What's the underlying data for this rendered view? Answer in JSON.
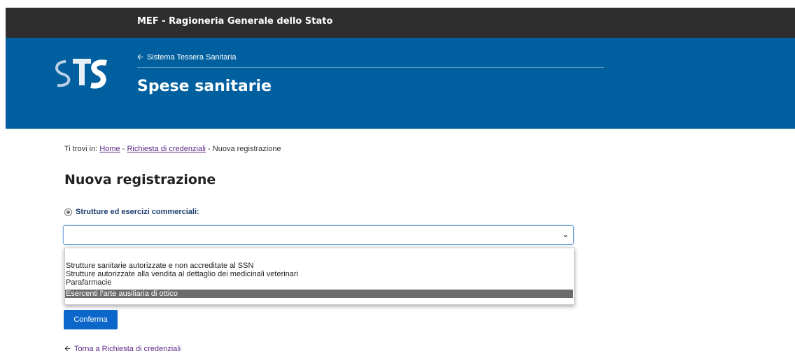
{
  "topbar": {
    "title": "MEF - Ragioneria Generale dello Stato"
  },
  "header": {
    "logo_text": "STS",
    "back_link": "Sistema Tessera Sanitaria",
    "title": "Spese sanitarie"
  },
  "breadcrumb": {
    "prefix": "Ti trovi in:",
    "items": [
      "Home",
      "Richiesta di credenziali",
      "Nuova registrazione"
    ],
    "separator": "-"
  },
  "page": {
    "title": "Nuova registrazione",
    "radio_label": "Strutture ed esercizi commerciali:",
    "select_value": "",
    "options": [
      "Strutture sanitarie autorizzate e non accreditate al SSN",
      "Strutture autorizzate alla vendita al dettaglio dei medicinali veterinari",
      "Parafarmacie",
      "Esercenti l'arte ausiliaria di ottico"
    ],
    "highlighted_option": 3,
    "confirm_label": "Conferma",
    "back_link": "Torna a Richiesta di credenziali"
  },
  "colors": {
    "topbar": "#2e2e2e",
    "header": "#00609f",
    "button": "#0b67c9",
    "link": "#5b2a86"
  }
}
